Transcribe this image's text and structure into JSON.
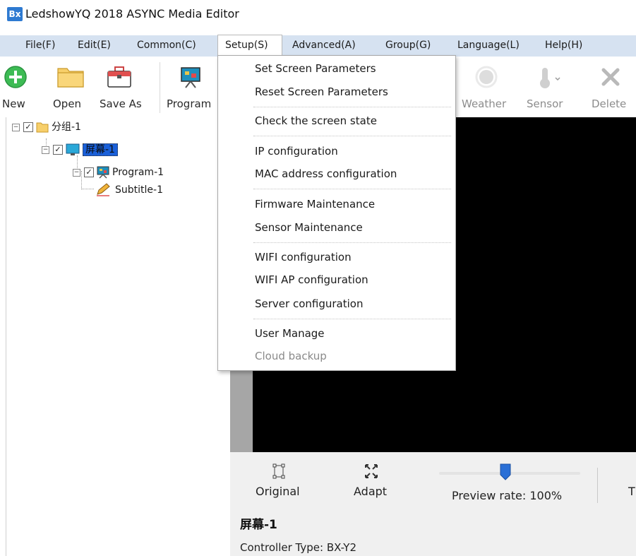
{
  "window": {
    "app_icon_text": "Bx",
    "title": "LedshowYQ 2018 ASYNC Media Editor"
  },
  "menubar": {
    "items": [
      "File(F)",
      "Edit(E)",
      "Common(C)",
      "Setup(S)",
      "Advanced(A)",
      "Group(G)",
      "Language(L)",
      "Help(H)"
    ],
    "active": "Setup(S)"
  },
  "toolbar": {
    "new_label": "New",
    "open_label": "Open",
    "saveas_label": "Save As",
    "program_label": "Program",
    "weather_label": "Weather",
    "sensor_label": "Sensor",
    "delete_label": "Delete"
  },
  "tree": {
    "group": "分组-1",
    "screen": "屏幕-1",
    "program": "Program-1",
    "subtitle": "Subtitle-1"
  },
  "setup_menu": {
    "items": [
      "Set Screen Parameters",
      "Reset Screen Parameters",
      "Check the screen state",
      "IP configuration",
      "MAC address configuration",
      "Firmware Maintenance",
      "Sensor Maintenance",
      "WIFI configuration",
      "WIFI AP configuration",
      "Server configuration",
      "User Manage",
      "Cloud backup"
    ],
    "disabled": [
      "Cloud backup"
    ]
  },
  "controls": {
    "original_label": "Original",
    "adapt_label": "Adapt",
    "preview_rate_label": "Preview rate: 100%",
    "preview_rate_value": 100,
    "partial_label": "T",
    "screen_name": "屏幕-1",
    "controller_type": "Controller Type: BX-Y2"
  },
  "colors": {
    "menubar_bg": "#d6e2f1",
    "selection_blue": "#1a60d9",
    "preview_bg": "#000000",
    "slider_thumb": "#2a6fd6"
  }
}
